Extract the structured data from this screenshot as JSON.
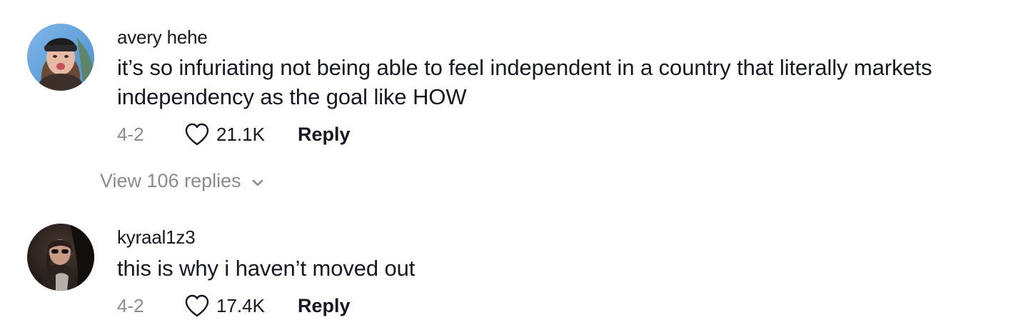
{
  "comments": [
    {
      "username": "avery hehe",
      "text": "it’s so infuriating not being able to feel independent in a country that literally markets independency as the goal like HOW",
      "date": "4-2",
      "likes": "21.1K",
      "reply_label": "Reply",
      "view_replies_label": "View 106 replies",
      "avatar_icon": "user-avatar-photo"
    },
    {
      "username": "kyraal1z3",
      "text": "this is why i haven’t moved out",
      "date": "4-2",
      "likes": "17.4K",
      "reply_label": "Reply",
      "avatar_icon": "user-avatar-photo"
    }
  ],
  "icons": {
    "like": "heart-icon",
    "expand": "chevron-down-icon"
  },
  "colors": {
    "primary_text": "#161823",
    "secondary_text": "#8a8b91",
    "background": "#ffffff"
  }
}
